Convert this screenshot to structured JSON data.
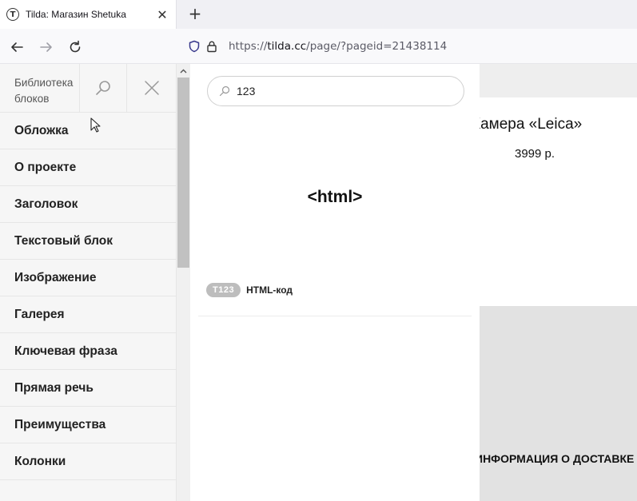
{
  "browser": {
    "tab": {
      "title": "Tilda: Магазин Shetuka",
      "favicon": "T"
    },
    "new_tab_label": "+",
    "url": {
      "prefix": "https://",
      "host": "tilda.cc",
      "path": "/page/?pageid=21438114"
    },
    "icons": [
      "back-arrow-icon",
      "forward-arrow-icon",
      "reload-icon",
      "shield-icon",
      "lock-icon",
      "close-icon",
      "plus-icon"
    ]
  },
  "sidebar": {
    "title": "Библиотека блоков",
    "items": [
      {
        "label": "Обложка"
      },
      {
        "label": "О проекте"
      },
      {
        "label": "Заголовок"
      },
      {
        "label": "Текстовый блок"
      },
      {
        "label": "Изображение"
      },
      {
        "label": "Галерея"
      },
      {
        "label": "Ключевая фраза"
      },
      {
        "label": "Прямая речь"
      },
      {
        "label": "Преимущества"
      },
      {
        "label": "Колонки"
      }
    ]
  },
  "panel": {
    "search": {
      "value": "123"
    },
    "preview_text": "<html>",
    "result": {
      "badge": "T123",
      "name": "HTML-код"
    }
  },
  "background_page": {
    "product_title": "Камера «Leica»",
    "price": "3999 р.",
    "delivery_heading": "ИНФОРМАЦИЯ О ДОСТАВКЕ"
  },
  "colors": {
    "badge": "#bdbdbd",
    "sidebar_bg": "#f6f6f6",
    "accent_shield": "#3a3a8c"
  }
}
